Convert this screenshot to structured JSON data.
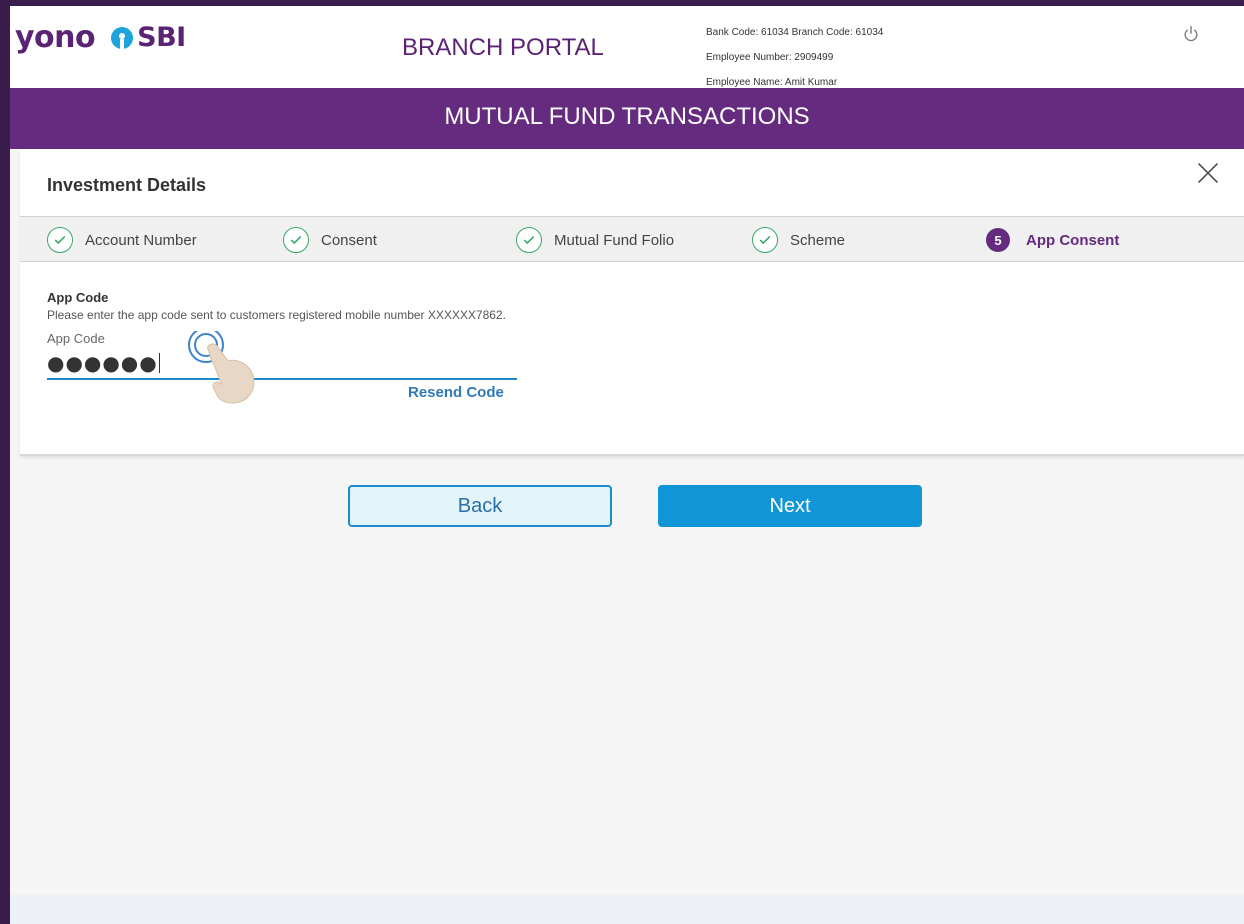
{
  "header": {
    "logo_yono": "yono",
    "logo_sbi": "SBI",
    "portal_title": "BRANCH PORTAL",
    "bank_branch": "Bank Code: 61034 Branch Code: 61034",
    "employee_number": "Employee Number: 2909499",
    "employee_name": "Employee Name: Amit Kumar",
    "power_icon": "power-icon"
  },
  "band": {
    "title": "MUTUAL FUND TRANSACTIONS"
  },
  "card": {
    "title": "Investment Details",
    "close_icon": "close-icon"
  },
  "steps": [
    {
      "label": "Account Number",
      "state": "done"
    },
    {
      "label": "Consent",
      "state": "done"
    },
    {
      "label": "Mutual Fund Folio",
      "state": "done"
    },
    {
      "label": "Scheme",
      "state": "done"
    },
    {
      "number": "5",
      "label": "App Consent",
      "state": "active"
    }
  ],
  "app_code": {
    "heading": "App Code",
    "description": "Please enter the app code sent to customers registered mobile number XXXXXX7862.",
    "label": "App Code",
    "value": "●●●●●●",
    "resend": "Resend Code"
  },
  "buttons": {
    "back": "Back",
    "next": "Next"
  },
  "colors": {
    "brand_purple": "#642b7e",
    "accent_blue": "#1095d6",
    "check_green": "#3aa86a"
  }
}
